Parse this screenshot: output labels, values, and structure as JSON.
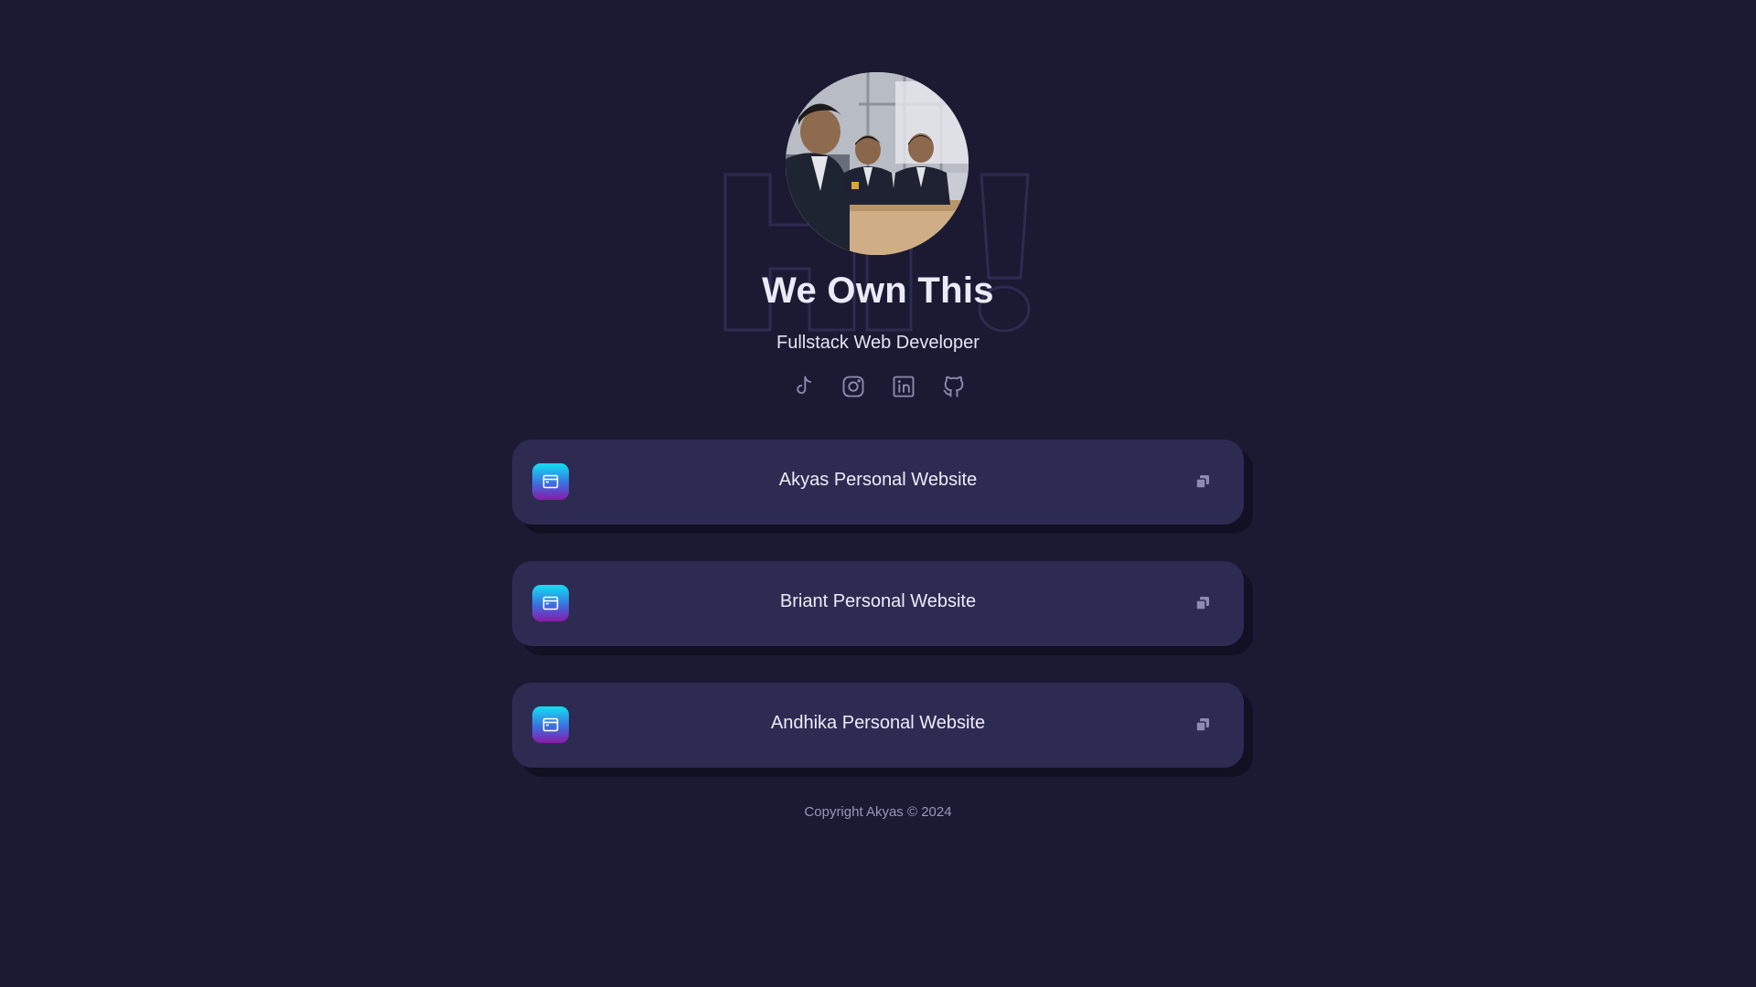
{
  "profile": {
    "name": "We Own This",
    "role": "Fullstack Web Developer",
    "backdrop_text": "Hi!"
  },
  "socials": [
    {
      "icon": "tiktok-icon"
    },
    {
      "icon": "instagram-icon"
    },
    {
      "icon": "linkedin-icon"
    },
    {
      "icon": "github-icon"
    }
  ],
  "links": [
    {
      "label": "Akyas Personal Website",
      "icon": "browser-window-icon",
      "action_icon": "copy-icon"
    },
    {
      "label": "Briant Personal Website",
      "icon": "browser-window-icon",
      "action_icon": "copy-icon"
    },
    {
      "label": "Andhika Personal Website",
      "icon": "browser-window-icon",
      "action_icon": "copy-icon"
    }
  ],
  "footer": {
    "copyright": "Copyright Akyas © 2024"
  },
  "colors": {
    "background": "#1b1a32",
    "card": "#2e2b53",
    "card_shadow": "#121124",
    "icon_gradient_top": "#13e0f0",
    "icon_gradient_bottom": "#8a1aa8",
    "social_icon": "#8e8bb0"
  }
}
